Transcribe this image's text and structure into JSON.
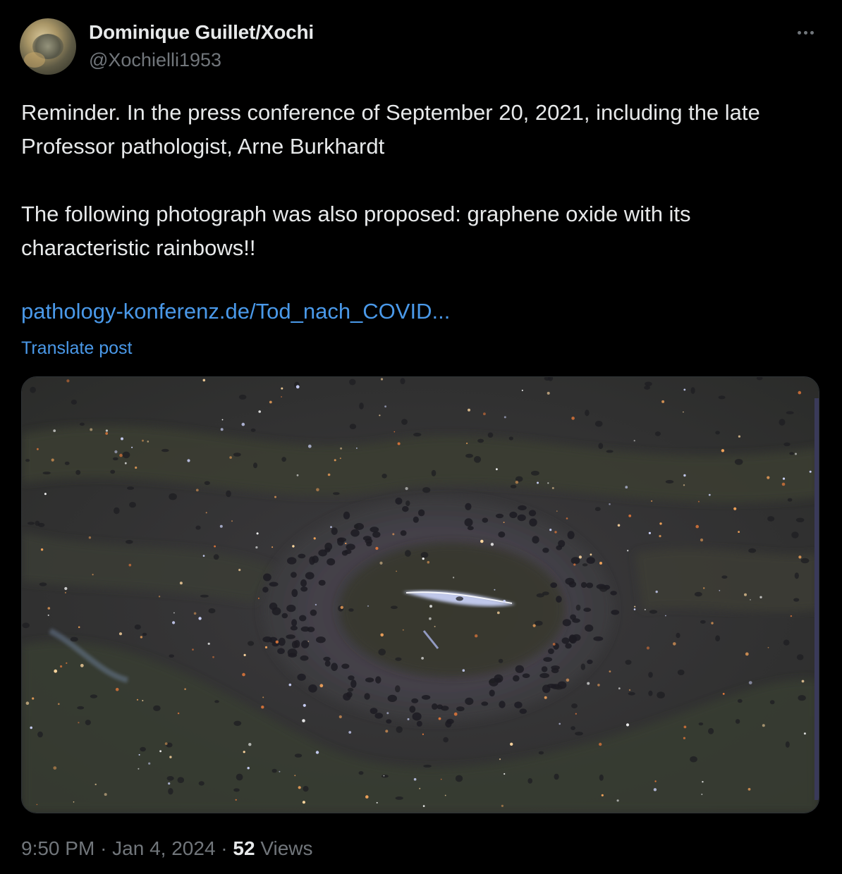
{
  "author": {
    "display_name": "Dominique Guillet/Xochi",
    "handle": "@Xochielli1953"
  },
  "tweet": {
    "paragraph1": "Reminder. In the press conference of September 20, 2021, including the late Professor pathologist, Arne Burkhardt",
    "paragraph2": "The following photograph was also proposed: graphene oxide with its characteristic rainbows!!",
    "link_text": "pathology-konferenz.de/Tod_nach_COVID...",
    "translate_label": "Translate post"
  },
  "meta": {
    "time": "9:50 PM",
    "separator": "·",
    "date": "Jan 4, 2024",
    "views_count": "52",
    "views_label": "Views"
  },
  "icons": {
    "more": "more-horizontal-icon"
  },
  "colors": {
    "background": "#000000",
    "text": "#e7e9ea",
    "muted": "#71767b",
    "link": "#4a99e9"
  }
}
